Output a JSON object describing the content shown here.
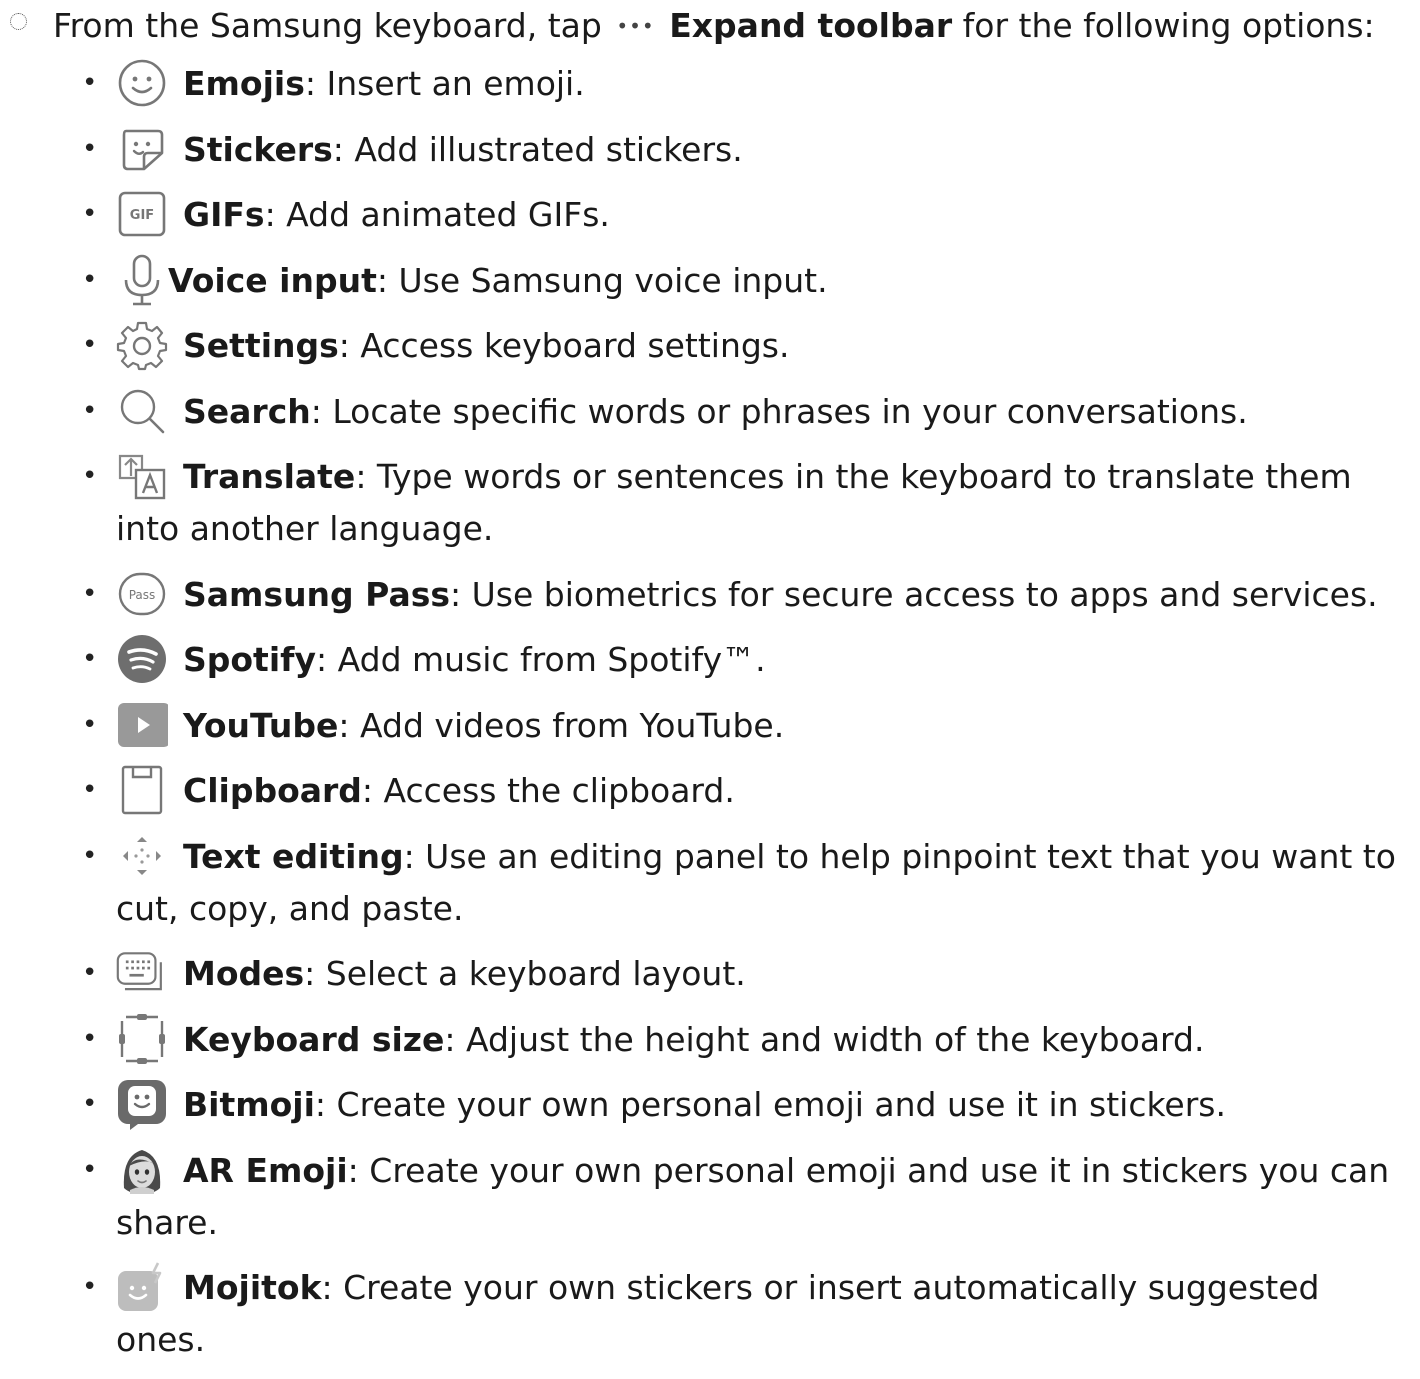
{
  "intro": {
    "prefix": "From the Samsung keyboard, tap",
    "dots": "•••",
    "bold": "Expand toolbar",
    "suffix": "for the following options:"
  },
  "items": [
    {
      "icon": "emoji-icon",
      "bold": "Emojis",
      "text": ": Insert an emoji."
    },
    {
      "icon": "sticker-icon",
      "bold": "Stickers",
      "text": ": Add illustrated stickers."
    },
    {
      "icon": "gif-icon",
      "bold": "GIFs",
      "text": ": Add animated GIFs."
    },
    {
      "icon": "microphone-icon",
      "bold": "Voice input",
      "text": ": Use Samsung voice input."
    },
    {
      "icon": "gear-icon",
      "bold": "Settings",
      "text": ": Access keyboard settings."
    },
    {
      "icon": "search-icon",
      "bold": "Search",
      "text": ": Locate specific words or phrases in your conversations."
    },
    {
      "icon": "translate-icon",
      "bold": "Translate",
      "text": ": Type words or sentences in the keyboard to translate them into another language."
    },
    {
      "icon": "samsung-pass-icon",
      "bold": "Samsung Pass",
      "text": ": Use biometrics for secure access to apps and services."
    },
    {
      "icon": "spotify-icon",
      "bold": "Spotify",
      "text": ": Add music from Spotify™."
    },
    {
      "icon": "youtube-icon",
      "bold": "YouTube",
      "text": ": Add videos from YouTube."
    },
    {
      "icon": "clipboard-icon",
      "bold": "Clipboard",
      "text": ": Access the clipboard."
    },
    {
      "icon": "text-editing-icon",
      "bold": "Text editing",
      "text": ": Use an editing panel to help pinpoint text that you want to cut, copy, and paste."
    },
    {
      "icon": "keyboard-modes-icon",
      "bold": "Modes",
      "text": ": Select a keyboard layout."
    },
    {
      "icon": "keyboard-size-icon",
      "bold": "Keyboard size",
      "text": ": Adjust the height and width of the keyboard."
    },
    {
      "icon": "bitmoji-icon",
      "bold": "Bitmoji",
      "text": ": Create your own personal emoji and use it in stickers."
    },
    {
      "icon": "ar-emoji-icon",
      "bold": "AR Emoji",
      "text": ": Create your own personal emoji and use it in stickers you can share."
    },
    {
      "icon": "mojitok-icon",
      "bold": "Mojitok",
      "text": ": Create your own stickers or insert automatically suggested ones."
    }
  ],
  "bullet": "•",
  "icon_labels": {
    "gif": "GIF",
    "pass": "Pass"
  }
}
